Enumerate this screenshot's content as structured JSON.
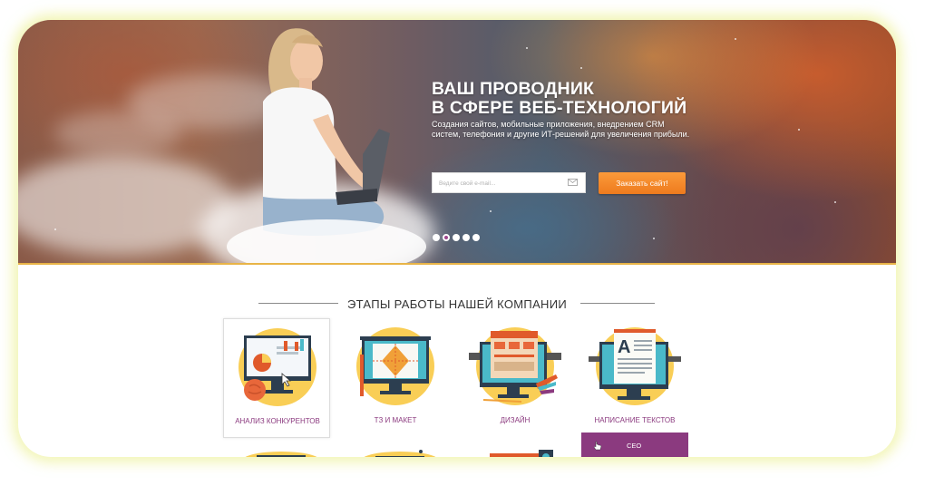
{
  "hero": {
    "title_line1": "ВАШ ПРОВОДНИК",
    "title_line2": "В СФЕРЕ ВЕБ-ТЕХНОЛОГИЙ",
    "subtitle": "Создания сайтов, мобильные приложения,  внедрением CRM систем, телефония и другие ИТ-решений для увеличения прибыли.",
    "email_placeholder": "Ведите свой e-mail...",
    "order_button": "Заказать сайт!",
    "slider_dots": 5,
    "active_dot": 2
  },
  "stages": {
    "title": "ЭТАПЫ РАБОТЫ НАШЕЙ КОМПАНИИ",
    "items": [
      {
        "label": "АНАЛИЗ КОНКУРЕНТОВ"
      },
      {
        "label": "ТЗ И МАКЕТ"
      },
      {
        "label": "ДИЗАЙН"
      },
      {
        "label": "НАПИСАНИЕ ТЕКСТОВ"
      }
    ],
    "popup_label": "CEO"
  },
  "colors": {
    "accent_orange": "#f08a28",
    "accent_purple": "#8b3a7f",
    "circle_yellow": "#f9ce56",
    "hero_line": "#e8b447"
  }
}
